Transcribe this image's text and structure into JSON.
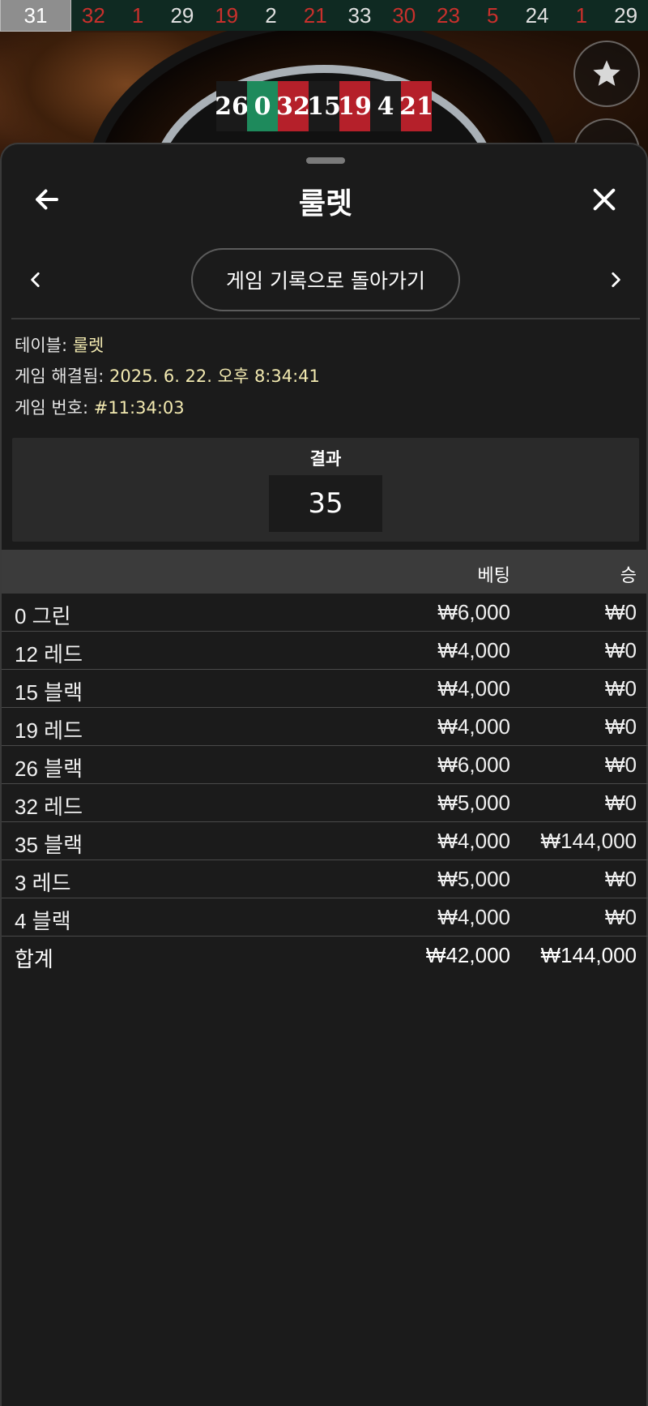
{
  "history": {
    "numbers": [
      {
        "value": "31",
        "color": "#ffffff"
      },
      {
        "value": "32",
        "color": "#c9302c"
      },
      {
        "value": "1",
        "color": "#c9302c"
      },
      {
        "value": "29",
        "color": "#e0e0e0"
      },
      {
        "value": "19",
        "color": "#c9302c"
      },
      {
        "value": "2",
        "color": "#e0e0e0"
      },
      {
        "value": "21",
        "color": "#c9302c"
      },
      {
        "value": "33",
        "color": "#e0e0e0"
      },
      {
        "value": "30",
        "color": "#c9302c"
      },
      {
        "value": "23",
        "color": "#c9302c"
      },
      {
        "value": "5",
        "color": "#c9302c"
      },
      {
        "value": "24",
        "color": "#e0e0e0"
      },
      {
        "value": "1",
        "color": "#c9302c"
      },
      {
        "value": "29",
        "color": "#e0e0e0"
      }
    ]
  },
  "wheel": {
    "pockets": [
      {
        "value": "26",
        "kind": "black"
      },
      {
        "value": "0",
        "kind": "green"
      },
      {
        "value": "32",
        "kind": "red"
      },
      {
        "value": "15",
        "kind": "black"
      },
      {
        "value": "19",
        "kind": "red"
      },
      {
        "value": "4",
        "kind": "black"
      },
      {
        "value": "21",
        "kind": "red"
      }
    ]
  },
  "side_buttons": {
    "favorite_icon": "star-icon",
    "more_icon": "plus-icon"
  },
  "sheet": {
    "title": "룰렛",
    "back_icon": "arrow-left-icon",
    "close_icon": "close-icon",
    "prev_icon": "chevron-left-icon",
    "next_icon": "chevron-right-icon",
    "back_to_history_label": "게임 기록으로 돌아가기"
  },
  "info": {
    "table_label": "테이블:",
    "table_value": "룰렛",
    "resolved_label": "게임 해결됨:",
    "resolved_value": "2025. 6. 22. 오후 8:34:41",
    "game_no_label": "게임 번호:",
    "game_no_value": "#11:34:03"
  },
  "result": {
    "label": "결과",
    "value": "35"
  },
  "table": {
    "headers": {
      "name": "",
      "bet": "베팅",
      "win": "승"
    },
    "rows": [
      {
        "name": "0 그린",
        "bet": "₩6,000",
        "win": "₩0"
      },
      {
        "name": "12 레드",
        "bet": "₩4,000",
        "win": "₩0"
      },
      {
        "name": "15 블랙",
        "bet": "₩4,000",
        "win": "₩0"
      },
      {
        "name": "19 레드",
        "bet": "₩4,000",
        "win": "₩0"
      },
      {
        "name": "26 블랙",
        "bet": "₩6,000",
        "win": "₩0"
      },
      {
        "name": "32 레드",
        "bet": "₩5,000",
        "win": "₩0"
      },
      {
        "name": "35 블랙",
        "bet": "₩4,000",
        "win": "₩144,000"
      },
      {
        "name": "3 레드",
        "bet": "₩5,000",
        "win": "₩0"
      },
      {
        "name": "4 블랙",
        "bet": "₩4,000",
        "win": "₩0"
      }
    ],
    "total": {
      "name": "합계",
      "bet": "₩42,000",
      "win": "₩144,000"
    }
  },
  "colors": {
    "background": "#1b1b1b",
    "header_row": "#3b3b3b",
    "result_box": "#2a2a2a",
    "info_value": "#f2e9b0",
    "history_bar": "#0f2a22",
    "red_number": "#c9302c"
  }
}
